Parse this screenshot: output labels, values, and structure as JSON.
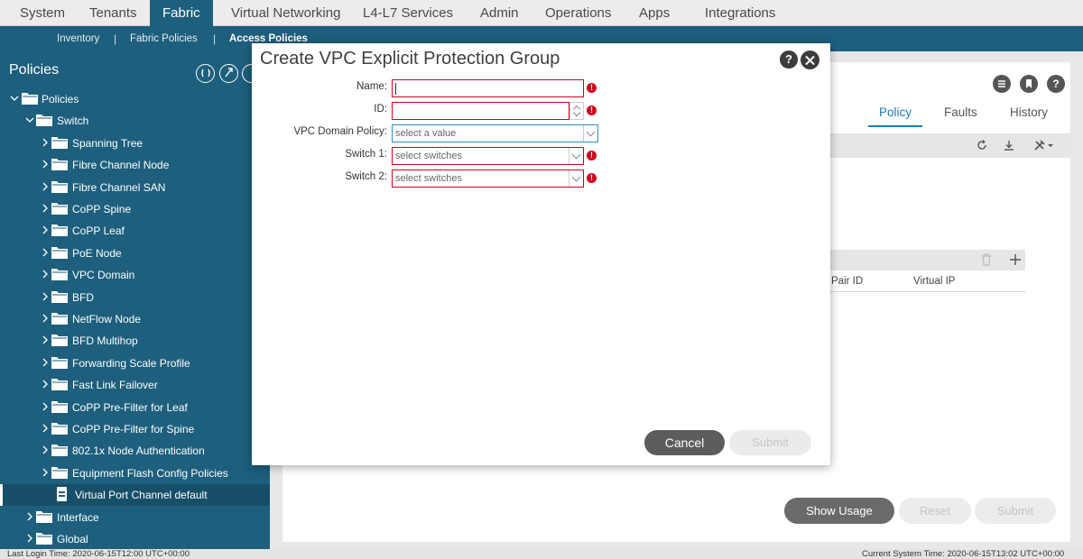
{
  "topnav": {
    "tabs": [
      "System",
      "Tenants",
      "Fabric",
      "Virtual Networking",
      "L4-L7 Services",
      "Admin",
      "Operations",
      "Apps",
      "Integrations"
    ],
    "active": "Fabric"
  },
  "subnav": {
    "items": [
      "Inventory",
      "Fabric Policies",
      "Access Policies"
    ],
    "separator": "|",
    "active": "Access Policies"
  },
  "sidebar": {
    "title": "Policies",
    "tools": [
      "tool-a",
      "tool-b"
    ],
    "tree": [
      {
        "label": "Policies",
        "level": 0,
        "expanded": true,
        "type": "folder"
      },
      {
        "label": "Switch",
        "level": 1,
        "expanded": true,
        "type": "folder"
      },
      {
        "label": "Spanning Tree",
        "level": 2,
        "type": "folder"
      },
      {
        "label": "Fibre Channel Node",
        "level": 2,
        "type": "folder"
      },
      {
        "label": "Fibre Channel SAN",
        "level": 2,
        "type": "folder"
      },
      {
        "label": "CoPP Spine",
        "level": 2,
        "type": "folder"
      },
      {
        "label": "CoPP Leaf",
        "level": 2,
        "type": "folder"
      },
      {
        "label": "PoE Node",
        "level": 2,
        "type": "folder"
      },
      {
        "label": "VPC Domain",
        "level": 2,
        "type": "folder"
      },
      {
        "label": "BFD",
        "level": 2,
        "type": "folder"
      },
      {
        "label": "NetFlow Node",
        "level": 2,
        "type": "folder"
      },
      {
        "label": "BFD Multihop",
        "level": 2,
        "type": "folder"
      },
      {
        "label": "Forwarding Scale Profile",
        "level": 2,
        "type": "folder"
      },
      {
        "label": "Fast Link Failover",
        "level": 2,
        "type": "folder"
      },
      {
        "label": "CoPP Pre-Filter for Leaf",
        "level": 2,
        "type": "folder"
      },
      {
        "label": "CoPP Pre-Filter for Spine",
        "level": 2,
        "type": "folder"
      },
      {
        "label": "802.1x Node Authentication",
        "level": 2,
        "type": "folder"
      },
      {
        "label": "Equipment Flash Config Policies",
        "level": 2,
        "type": "folder"
      },
      {
        "label": "Virtual Port Channel default",
        "level": 2,
        "type": "doc",
        "selected": true
      },
      {
        "label": "Interface",
        "level": 1,
        "type": "folder"
      },
      {
        "label": "Global",
        "level": 1,
        "type": "folder"
      }
    ]
  },
  "background": {
    "tabs": [
      "Policy",
      "Faults",
      "History"
    ],
    "active_tab": "Policy",
    "columns": [
      "Pair ID",
      "Virtual IP"
    ],
    "buttons": {
      "show_usage": "Show Usage",
      "reset": "Reset",
      "submit": "Submit"
    },
    "header_icons": [
      "list-icon",
      "bookmark-icon",
      "help-icon"
    ],
    "toolbar_icons": [
      "refresh-icon",
      "download-icon",
      "tools-icon"
    ],
    "table_icons": [
      "trash-icon",
      "plus-icon"
    ]
  },
  "dialog": {
    "title": "Create VPC Explicit Protection Group",
    "help": "?",
    "fields": [
      {
        "label": "Name:",
        "value": "",
        "placeholder": "",
        "kind": "text",
        "required": true
      },
      {
        "label": "ID:",
        "value": "",
        "placeholder": "",
        "kind": "number",
        "required": true
      },
      {
        "label": "VPC Domain Policy:",
        "value": "select a value",
        "kind": "dropdown",
        "required": false
      },
      {
        "label": "Switch 1:",
        "value": "select switches",
        "kind": "dropdown",
        "required": true
      },
      {
        "label": "Switch 2:",
        "value": "select switches",
        "kind": "dropdown",
        "required": true
      }
    ],
    "error_mark": "!",
    "cancel_label": "Cancel",
    "submit_label": "Submit"
  },
  "statusbar": {
    "last_login": "Last Login Time: 2020-06-15T12:00 UTC+00:00",
    "current_time": "Current System Time: 2020-06-15T13:02 UTC+00:00"
  },
  "colors": {
    "brand": "#1d5f7d",
    "accent": "#1d79b6",
    "error": "#d0021b"
  }
}
